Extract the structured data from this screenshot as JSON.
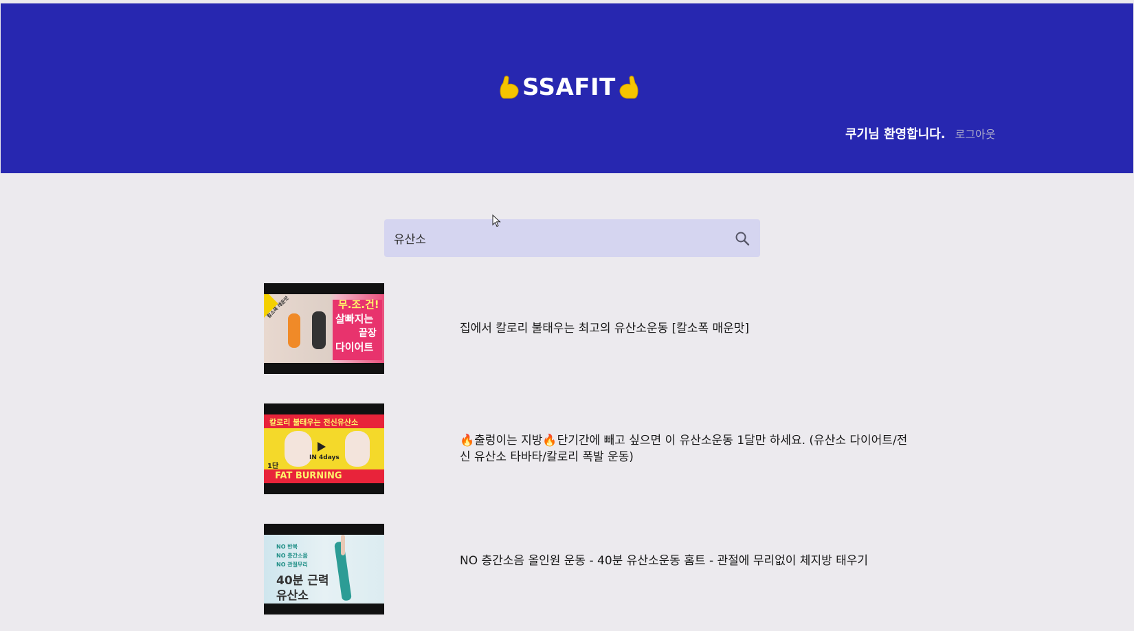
{
  "header": {
    "logo_text": "SSAFIT",
    "welcome_text": "쿠기님 환영합니다.",
    "logout_label": "로그아웃"
  },
  "search": {
    "value": "유산소",
    "placeholder": ""
  },
  "results": [
    {
      "title": "집에서 칼로리 불태우는 최고의 유산소운동 [칼소폭 매운맛]",
      "thumb_text_lines": [
        "무.조.건!",
        "살빠지는",
        "끝장",
        "다이어트"
      ],
      "thumb_side_text": "칼소폭 매운맛"
    },
    {
      "title": "🔥출렁이는 지방🔥단기간에 빼고 싶으면 이 유산소운동 1달만 하세요. (유산소 다이어트/전신 유산소 타바타/칼로리 폭발 운동)",
      "thumb_top_text": "칼로리 불태우는 전신유산소",
      "thumb_mid_text": "IN 4days",
      "thumb_step_text": "1단",
      "thumb_bottom_text": "FAT BURNING"
    },
    {
      "title": "NO 층간소음 올인원 운동 - 40분 유산소운동 홈트 - 관절에 무리없이 체지방 태우기",
      "thumb_tag_lines": [
        "NO 반복",
        "NO 층간소음",
        "NO 관절무리"
      ],
      "thumb_big_lines": [
        "40분 근력",
        "유산소"
      ]
    }
  ],
  "colors": {
    "header_bg": "#2727b0",
    "page_bg": "#eceaee",
    "search_bg": "#d5d5f0",
    "logo_text": "#ffffff",
    "icon_yellow": "#f5c400"
  },
  "icons": {
    "logo_left": "flexed-biceps-icon",
    "logo_right": "flexed-biceps-icon",
    "search": "search-icon",
    "cursor": "mouse-pointer-icon"
  }
}
